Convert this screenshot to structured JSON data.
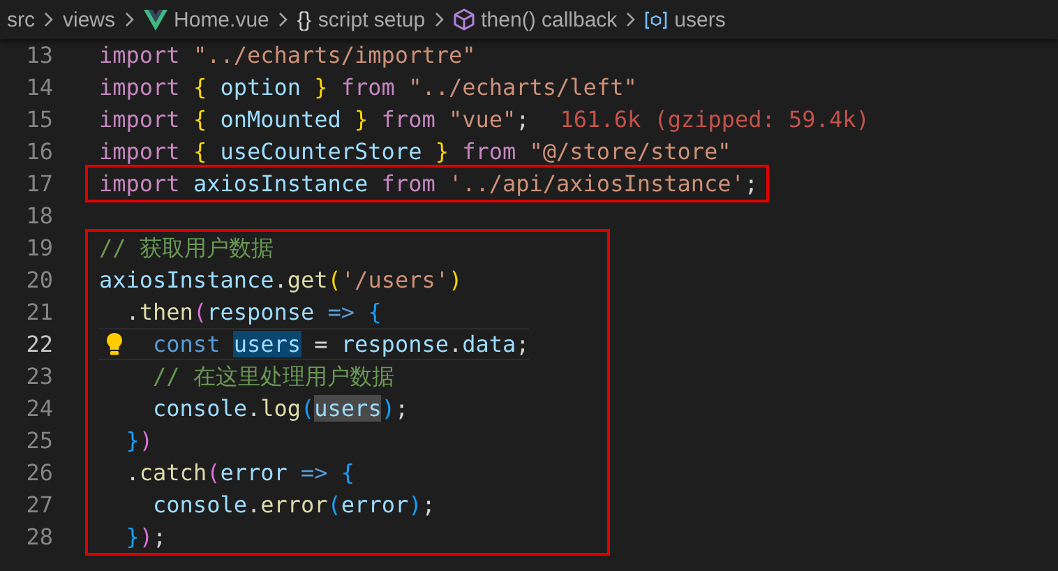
{
  "breadcrumbs": [
    {
      "label": "src",
      "kind": "plain"
    },
    {
      "label": "views",
      "kind": "plain"
    },
    {
      "label": "Home.vue",
      "kind": "vue"
    },
    {
      "label": "script setup",
      "kind": "braces",
      "glyph": "{}"
    },
    {
      "label": "then() callback",
      "kind": "method"
    },
    {
      "label": "users",
      "kind": "variable"
    }
  ],
  "code_blocks": [
    {
      "annotated": false,
      "lines": [
        {
          "number": "13",
          "current": false,
          "tokens": [
            {
              "kind": "kw",
              "text": "import "
            },
            {
              "kind": "str",
              "text": "\"../echarts/importre\""
            }
          ]
        },
        {
          "number": "14",
          "current": false,
          "tokens": [
            {
              "kind": "kw",
              "text": "import "
            },
            {
              "kind": "b1",
              "text": "{ "
            },
            {
              "kind": "var",
              "text": "option "
            },
            {
              "kind": "b1",
              "text": "} "
            },
            {
              "kind": "kw",
              "text": "from "
            },
            {
              "kind": "str",
              "text": "\"../echarts/left\""
            }
          ]
        },
        {
          "number": "15",
          "current": false,
          "tokens": [
            {
              "kind": "kw",
              "text": "import "
            },
            {
              "kind": "b1",
              "text": "{ "
            },
            {
              "kind": "var",
              "text": "onMounted "
            },
            {
              "kind": "b1",
              "text": "} "
            },
            {
              "kind": "kw",
              "text": "from "
            },
            {
              "kind": "str",
              "text": "\"vue\""
            },
            {
              "kind": "p",
              "text": ";"
            }
          ],
          "hint": "161.6k (gzipped: 59.4k)"
        },
        {
          "number": "16",
          "current": false,
          "tokens": [
            {
              "kind": "kw",
              "text": "import "
            },
            {
              "kind": "b1",
              "text": "{ "
            },
            {
              "kind": "var",
              "text": "useCounterStore "
            },
            {
              "kind": "b1",
              "text": "} "
            },
            {
              "kind": "kw",
              "text": "from "
            },
            {
              "kind": "str",
              "text": "\"@/store/store\""
            }
          ]
        }
      ]
    },
    {
      "annotated": true,
      "lines": [
        {
          "number": "17",
          "current": false,
          "tokens": [
            {
              "kind": "kw",
              "text": "import "
            },
            {
              "kind": "var",
              "text": "axiosInstance "
            },
            {
              "kind": "kw",
              "text": "from "
            },
            {
              "kind": "str",
              "text": "'../api/axiosInstance'"
            },
            {
              "kind": "p",
              "text": ";"
            }
          ]
        }
      ]
    },
    {
      "annotated": false,
      "lines": [
        {
          "number": "18",
          "current": false
        }
      ]
    },
    {
      "annotated": true,
      "lines": [
        {
          "number": "19",
          "current": false,
          "tokens": [
            {
              "kind": "cm",
              "text": "// 获取用户数据"
            }
          ]
        },
        {
          "number": "20",
          "current": false,
          "tokens": [
            {
              "kind": "var",
              "text": "axiosInstance"
            },
            {
              "kind": "p",
              "text": "."
            },
            {
              "kind": "fn",
              "text": "get"
            },
            {
              "kind": "b1",
              "text": "("
            },
            {
              "kind": "str",
              "text": "'/users'"
            },
            {
              "kind": "b1",
              "text": ")"
            }
          ]
        },
        {
          "number": "21",
          "current": false,
          "tokens": [
            {
              "kind": "p",
              "text": "  ."
            },
            {
              "kind": "fn",
              "text": "then"
            },
            {
              "kind": "b2",
              "text": "("
            },
            {
              "kind": "var",
              "text": "response "
            },
            {
              "kind": "st",
              "text": "=> "
            },
            {
              "kind": "b3",
              "text": "{"
            }
          ]
        },
        {
          "number": "22",
          "current": true,
          "lightbulb": true,
          "tokens": [
            {
              "kind": "st",
              "text": "    const "
            },
            {
              "kind": "var",
              "text": "users",
              "highlighted": true,
              "definition": true
            },
            {
              "kind": "p",
              "text": " = "
            },
            {
              "kind": "var",
              "text": "response"
            },
            {
              "kind": "p",
              "text": "."
            },
            {
              "kind": "var",
              "text": "data"
            },
            {
              "kind": "p",
              "text": ";"
            }
          ]
        },
        {
          "number": "23",
          "current": false,
          "tokens": [
            {
              "kind": "cm",
              "text": "    // 在这里处理用户数据"
            }
          ]
        },
        {
          "number": "24",
          "current": false,
          "tokens": [
            {
              "kind": "var",
              "text": "    console"
            },
            {
              "kind": "p",
              "text": "."
            },
            {
              "kind": "fn",
              "text": "log"
            },
            {
              "kind": "b3",
              "text": "("
            },
            {
              "kind": "var",
              "text": "users",
              "highlighted": true,
              "definition": false
            },
            {
              "kind": "b3",
              "text": ")"
            },
            {
              "kind": "p",
              "text": ";"
            }
          ]
        },
        {
          "number": "25",
          "current": false,
          "tokens": [
            {
              "kind": "b3",
              "text": "  }"
            },
            {
              "kind": "b2",
              "text": ")"
            }
          ]
        },
        {
          "number": "26",
          "current": false,
          "tokens": [
            {
              "kind": "p",
              "text": "  ."
            },
            {
              "kind": "fn",
              "text": "catch"
            },
            {
              "kind": "b2",
              "text": "("
            },
            {
              "kind": "var",
              "text": "error "
            },
            {
              "kind": "st",
              "text": "=> "
            },
            {
              "kind": "b3",
              "text": "{"
            }
          ]
        },
        {
          "number": "27",
          "current": false,
          "tokens": [
            {
              "kind": "var",
              "text": "    console"
            },
            {
              "kind": "p",
              "text": "."
            },
            {
              "kind": "fn",
              "text": "error"
            },
            {
              "kind": "b3",
              "text": "("
            },
            {
              "kind": "var",
              "text": "error"
            },
            {
              "kind": "b3",
              "text": ")"
            },
            {
              "kind": "p",
              "text": ";"
            }
          ]
        },
        {
          "number": "28",
          "current": false,
          "tokens": [
            {
              "kind": "b3",
              "text": "  }"
            },
            {
              "kind": "b2",
              "text": ")"
            },
            {
              "kind": "p",
              "text": ";"
            }
          ]
        }
      ]
    }
  ]
}
